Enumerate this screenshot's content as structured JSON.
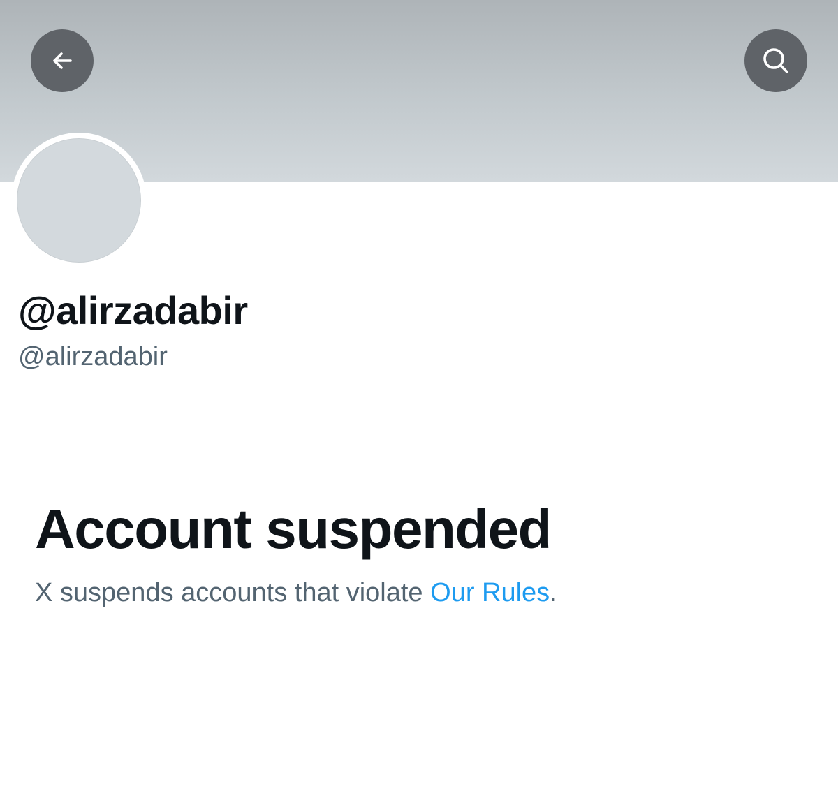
{
  "header": {
    "back_icon": "arrow-left-icon",
    "search_icon": "search-icon",
    "banner_color": "#b9c0c4",
    "button_color": "#5f6368"
  },
  "profile": {
    "display_name": "@alirzadabir",
    "handle": "@alirzadabir",
    "avatar_color": "#d3d9dd"
  },
  "notice": {
    "title": "Account suspended",
    "description_prefix": "X suspends accounts that violate ",
    "link_text": "Our Rules",
    "description_suffix": ".",
    "link_color": "#1d9bf0"
  }
}
